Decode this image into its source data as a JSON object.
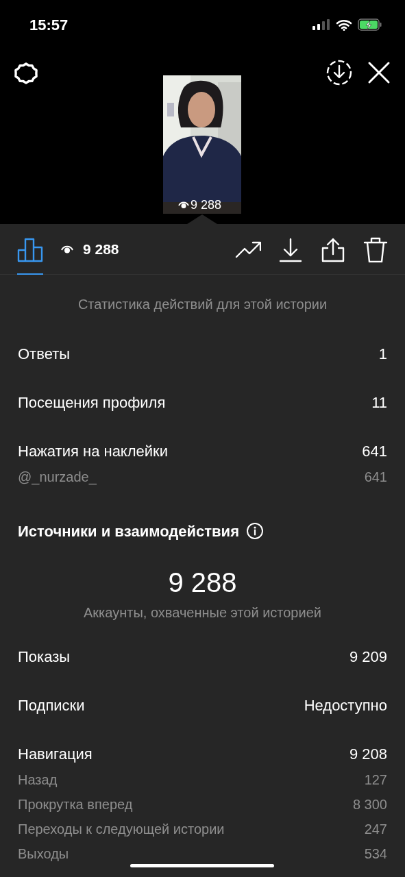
{
  "status_bar": {
    "time": "15:57"
  },
  "story": {
    "kind": "picture",
    "views": "9 288"
  },
  "tabs": [
    {
      "kind": "insights",
      "selected": true
    },
    {
      "kind": "viewers",
      "label": "9 288",
      "selected": false
    }
  ],
  "actions": [
    {
      "kind": "promote"
    },
    {
      "kind": "download"
    },
    {
      "kind": "share"
    },
    {
      "kind": "delete"
    }
  ],
  "sections": [
    {
      "subtitle": "Статистика действий для этой истории",
      "groups": [
        {
          "label": "Ответы",
          "value": "1"
        },
        {
          "label": "Посещения профиля",
          "value": "11"
        },
        {
          "label": "Нажатия на наклейки",
          "value": "641",
          "children": [
            {
              "label": "@_nurzade_",
              "value": "641"
            }
          ]
        }
      ]
    },
    {
      "title": "Источники и взаимодействия",
      "info": true,
      "total": "9 288",
      "subtitle": "Аккаунты, охваченные этой историей",
      "groups": [
        {
          "label": "Показы",
          "value": "9 209"
        },
        {
          "label": "Подписки",
          "value": "Недоступно"
        },
        {
          "label": "Навигация",
          "value": "9 208",
          "children": [
            {
              "label": "Назад",
              "value": "127"
            },
            {
              "label": "Прокрутка вперед",
              "value": "8 300"
            },
            {
              "label": "Переходы к следующей истории",
              "value": "247"
            },
            {
              "label": "Выходы",
              "value": "534"
            }
          ]
        }
      ]
    }
  ]
}
